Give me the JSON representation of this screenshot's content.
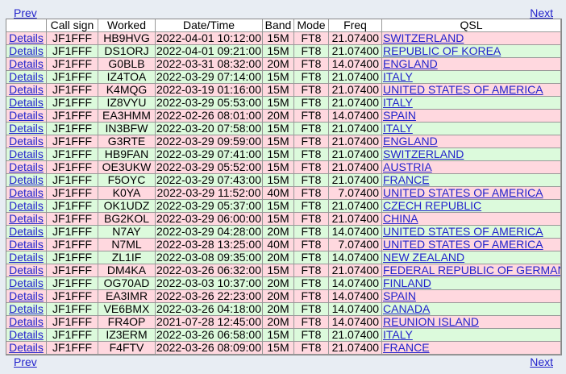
{
  "nav": {
    "prev_label": "Prev",
    "next_label": "Next"
  },
  "headers": [
    "",
    "Call sign",
    "Worked",
    "Date/Time",
    "Band",
    "Mode",
    "Freq",
    "QSL"
  ],
  "details_label": "Details",
  "row_colors": {
    "pink": "#ffd8df",
    "green": "#dcfadc",
    "link": "#2222cc"
  },
  "rows": [
    {
      "call": "JF1FFF",
      "worked": "HB9HVG",
      "datetime": "2022-04-01 10:12:00",
      "band": "15M",
      "mode": "FT8",
      "freq": "21.07400",
      "qsl": "SWITZERLAND",
      "color": "pink"
    },
    {
      "call": "JF1FFF",
      "worked": "DS1ORJ",
      "datetime": "2022-04-01 09:21:00",
      "band": "15M",
      "mode": "FT8",
      "freq": "21.07400",
      "qsl": "REPUBLIC OF KOREA",
      "color": "green"
    },
    {
      "call": "JF1FFF",
      "worked": "G0BLB",
      "datetime": "2022-03-31 08:32:00",
      "band": "20M",
      "mode": "FT8",
      "freq": "14.07400",
      "qsl": "ENGLAND",
      "color": "pink"
    },
    {
      "call": "JF1FFF",
      "worked": "IZ4TOA",
      "datetime": "2022-03-29 07:14:00",
      "band": "15M",
      "mode": "FT8",
      "freq": "21.07400",
      "qsl": "ITALY",
      "color": "green"
    },
    {
      "call": "JF1FFF",
      "worked": "K4MQG",
      "datetime": "2022-03-19 01:16:00",
      "band": "15M",
      "mode": "FT8",
      "freq": "21.07400",
      "qsl": "UNITED STATES OF AMERICA",
      "color": "pink"
    },
    {
      "call": "JF1FFF",
      "worked": "IZ8VYU",
      "datetime": "2022-03-29 05:53:00",
      "band": "15M",
      "mode": "FT8",
      "freq": "21.07400",
      "qsl": "ITALY",
      "color": "green"
    },
    {
      "call": "JF1FFF",
      "worked": "EA3HMM",
      "datetime": "2022-02-26 08:01:00",
      "band": "20M",
      "mode": "FT8",
      "freq": "14.07400",
      "qsl": "SPAIN",
      "color": "pink"
    },
    {
      "call": "JF1FFF",
      "worked": "IN3BFW",
      "datetime": "2022-03-20 07:58:00",
      "band": "15M",
      "mode": "FT8",
      "freq": "21.07400",
      "qsl": "ITALY",
      "color": "green"
    },
    {
      "call": "JF1FFF",
      "worked": "G3RTE",
      "datetime": "2022-03-29 09:59:00",
      "band": "15M",
      "mode": "FT8",
      "freq": "21.07400",
      "qsl": "ENGLAND",
      "color": "pink"
    },
    {
      "call": "JF1FFF",
      "worked": "HB9FAN",
      "datetime": "2022-03-29 07:41:00",
      "band": "15M",
      "mode": "FT8",
      "freq": "21.07400",
      "qsl": "SWITZERLAND",
      "color": "green"
    },
    {
      "call": "JF1FFF",
      "worked": "OE3UKW",
      "datetime": "2022-03-29 05:52:00",
      "band": "15M",
      "mode": "FT8",
      "freq": "21.07400",
      "qsl": "AUSTRIA",
      "color": "pink"
    },
    {
      "call": "JF1FFF",
      "worked": "F5OYC",
      "datetime": "2022-03-29 07:43:00",
      "band": "15M",
      "mode": "FT8",
      "freq": "21.07400",
      "qsl": "FRANCE",
      "color": "green"
    },
    {
      "call": "JF1FFF",
      "worked": "K0YA",
      "datetime": "2022-03-29 11:52:00",
      "band": "40M",
      "mode": "FT8",
      "freq": "7.07400",
      "qsl": "UNITED STATES OF AMERICA",
      "color": "pink"
    },
    {
      "call": "JF1FFF",
      "worked": "OK1UDZ",
      "datetime": "2022-03-29 05:37:00",
      "band": "15M",
      "mode": "FT8",
      "freq": "21.07400",
      "qsl": "CZECH REPUBLIC",
      "color": "green"
    },
    {
      "call": "JF1FFF",
      "worked": "BG2KOL",
      "datetime": "2022-03-29 06:00:00",
      "band": "15M",
      "mode": "FT8",
      "freq": "21.07400",
      "qsl": "CHINA",
      "color": "pink"
    },
    {
      "call": "JF1FFF",
      "worked": "N7AY",
      "datetime": "2022-03-29 04:28:00",
      "band": "20M",
      "mode": "FT8",
      "freq": "14.07400",
      "qsl": "UNITED STATES OF AMERICA",
      "color": "green"
    },
    {
      "call": "JF1FFF",
      "worked": "N7ML",
      "datetime": "2022-03-28 13:25:00",
      "band": "40M",
      "mode": "FT8",
      "freq": "7.07400",
      "qsl": "UNITED STATES OF AMERICA",
      "color": "pink"
    },
    {
      "call": "JF1FFF",
      "worked": "ZL1IF",
      "datetime": "2022-03-08 09:35:00",
      "band": "20M",
      "mode": "FT8",
      "freq": "14.07400",
      "qsl": "NEW ZEALAND",
      "color": "green"
    },
    {
      "call": "JF1FFF",
      "worked": "DM4KA",
      "datetime": "2022-03-26 06:32:00",
      "band": "15M",
      "mode": "FT8",
      "freq": "21.07400",
      "qsl": "FEDERAL REPUBLIC OF GERMANY",
      "color": "pink"
    },
    {
      "call": "JF1FFF",
      "worked": "OG70AD",
      "datetime": "2022-03-03 10:37:00",
      "band": "20M",
      "mode": "FT8",
      "freq": "14.07400",
      "qsl": "FINLAND",
      "color": "green"
    },
    {
      "call": "JF1FFF",
      "worked": "EA3IMR",
      "datetime": "2022-03-26 22:23:00",
      "band": "20M",
      "mode": "FT8",
      "freq": "14.07400",
      "qsl": "SPAIN",
      "color": "pink"
    },
    {
      "call": "JF1FFF",
      "worked": "VE6BMX",
      "datetime": "2022-03-26 04:18:00",
      "band": "20M",
      "mode": "FT8",
      "freq": "14.07400",
      "qsl": "CANADA",
      "color": "green"
    },
    {
      "call": "JF1FFF",
      "worked": "FR4OP",
      "datetime": "2021-07-28 12:45:00",
      "band": "20M",
      "mode": "FT8",
      "freq": "14.07400",
      "qsl": "REUNION ISLAND",
      "color": "pink"
    },
    {
      "call": "JF1FFF",
      "worked": "IZ3ERM",
      "datetime": "2022-03-26 06:58:00",
      "band": "15M",
      "mode": "FT8",
      "freq": "21.07400",
      "qsl": "ITALY",
      "color": "green"
    },
    {
      "call": "JF1FFF",
      "worked": "F4FTV",
      "datetime": "2022-03-26 08:09:00",
      "band": "15M",
      "mode": "FT8",
      "freq": "21.07400",
      "qsl": "FRANCE",
      "color": "pink"
    }
  ]
}
